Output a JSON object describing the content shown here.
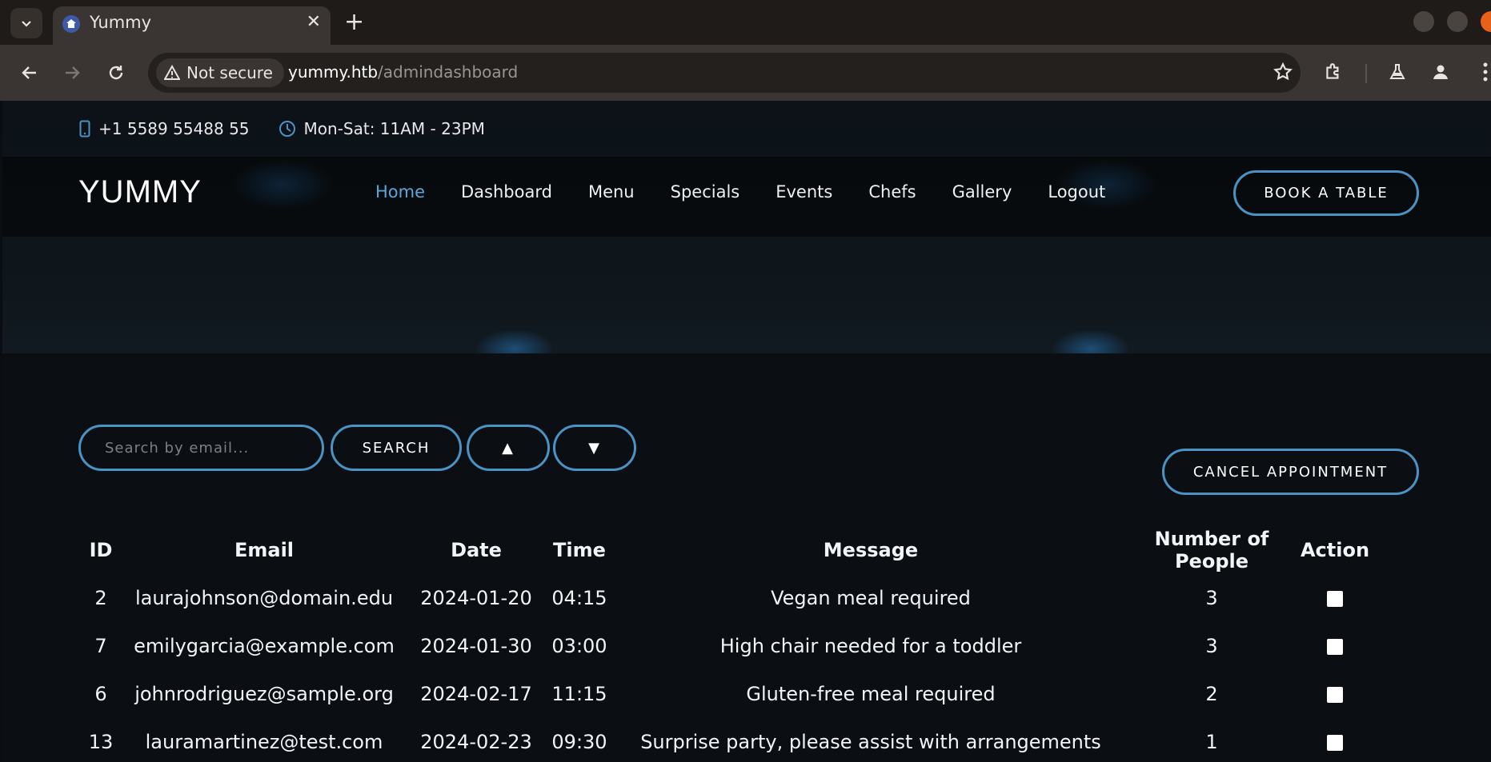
{
  "browser": {
    "tab_title": "Yummy",
    "security_label": "Not secure",
    "url_host": "yummy.htb",
    "url_path": "/admindashboard"
  },
  "site": {
    "phone": "+1 5589 55488 55",
    "hours": "Mon-Sat: 11AM - 23PM",
    "logo": "YUMMY",
    "nav": [
      {
        "label": "Home",
        "active": true
      },
      {
        "label": "Dashboard"
      },
      {
        "label": "Menu"
      },
      {
        "label": "Specials"
      },
      {
        "label": "Events"
      },
      {
        "label": "Chefs"
      },
      {
        "label": "Gallery"
      },
      {
        "label": "Logout"
      }
    ],
    "book_button": "BOOK A TABLE",
    "accent_color": "#4b93c4",
    "active_link_color": "#5aa7d9"
  },
  "controls": {
    "search_placeholder": "Search by email...",
    "search_button": "SEARCH",
    "sort_up": "▲",
    "sort_down": "▼",
    "cancel_button": "CANCEL APPOINTMENT"
  },
  "table": {
    "headers": [
      "ID",
      "Email",
      "Date",
      "Time",
      "Message",
      "Number of People",
      "Action"
    ],
    "rows": [
      {
        "id": "2",
        "email": "laurajohnson@domain.edu",
        "date": "2024-01-20",
        "time": "04:15",
        "message": "Vegan meal required",
        "people": "3"
      },
      {
        "id": "7",
        "email": "emilygarcia@example.com",
        "date": "2024-01-30",
        "time": "03:00",
        "message": "High chair needed for a toddler",
        "people": "3"
      },
      {
        "id": "6",
        "email": "johnrodriguez@sample.org",
        "date": "2024-02-17",
        "time": "11:15",
        "message": "Gluten-free meal required",
        "people": "2"
      },
      {
        "id": "13",
        "email": "lauramartinez@test.com",
        "date": "2024-02-23",
        "time": "09:30",
        "message": "Surprise party, please assist with arrangements",
        "people": "1"
      }
    ]
  }
}
